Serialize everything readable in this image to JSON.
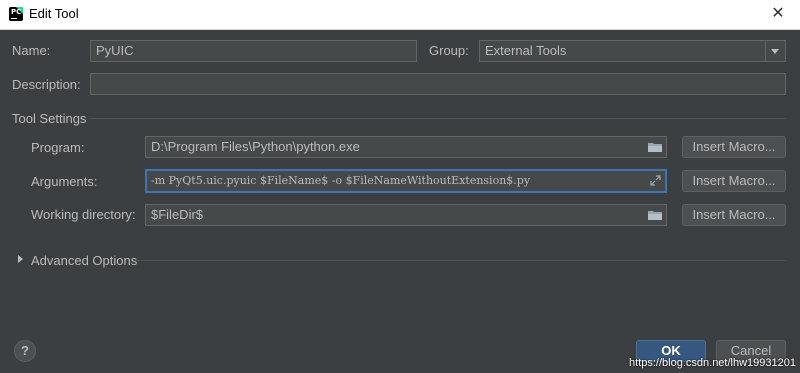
{
  "window": {
    "title": "Edit Tool",
    "close_glyph": "✕"
  },
  "form": {
    "name_label": "Name:",
    "name_value": "PyUIC",
    "group_label": "Group:",
    "group_value": "External Tools",
    "description_label": "Description:",
    "description_value": ""
  },
  "tool_settings": {
    "section_label": "Tool Settings",
    "program_label": "Program:",
    "program_value": "D:\\Program Files\\Python\\python.exe",
    "arguments_label": "Arguments:",
    "arguments_value": "-m PyQt5.uic.pyuic $FileName$ -o $FileNameWithoutExtension$.py",
    "working_dir_label": "Working directory:",
    "working_dir_value": "$FileDir$",
    "insert_macro_label": "Insert Macro..."
  },
  "advanced": {
    "label": "Advanced Options"
  },
  "footer": {
    "ok_label": "OK",
    "cancel_label": "Cancel",
    "help_glyph": "?"
  },
  "watermark": "https://blog.csdn.net/lhw19931201",
  "colors": {
    "background": "#3c3f41",
    "field": "#45494a",
    "accent": "#3d75b0",
    "primary_button": "#365880"
  }
}
